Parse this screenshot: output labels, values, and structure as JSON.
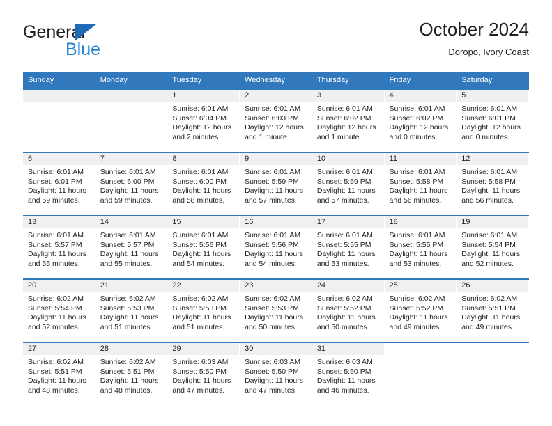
{
  "brand": {
    "word_one": "General",
    "word_two": "Blue",
    "flag_icon": "triangle-flag-icon",
    "colors": {
      "blue": "#2183d4",
      "flag": "#1f6cb4",
      "dark": "#231f20"
    }
  },
  "header": {
    "title": "October 2024",
    "subtitle": "Doropo, Ivory Coast"
  },
  "calendar": {
    "accent_color": "#3278bd",
    "daynum_bg": "#f0f0f0",
    "weekday_headers": [
      "Sunday",
      "Monday",
      "Tuesday",
      "Wednesday",
      "Thursday",
      "Friday",
      "Saturday"
    ],
    "weeks": [
      [
        {
          "day": "",
          "lines": []
        },
        {
          "day": "",
          "lines": []
        },
        {
          "day": "1",
          "lines": [
            "Sunrise: 6:01 AM",
            "Sunset: 6:04 PM",
            "Daylight: 12 hours and 2 minutes."
          ]
        },
        {
          "day": "2",
          "lines": [
            "Sunrise: 6:01 AM",
            "Sunset: 6:03 PM",
            "Daylight: 12 hours and 1 minute."
          ]
        },
        {
          "day": "3",
          "lines": [
            "Sunrise: 6:01 AM",
            "Sunset: 6:02 PM",
            "Daylight: 12 hours and 1 minute."
          ]
        },
        {
          "day": "4",
          "lines": [
            "Sunrise: 6:01 AM",
            "Sunset: 6:02 PM",
            "Daylight: 12 hours and 0 minutes."
          ]
        },
        {
          "day": "5",
          "lines": [
            "Sunrise: 6:01 AM",
            "Sunset: 6:01 PM",
            "Daylight: 12 hours and 0 minutes."
          ]
        }
      ],
      [
        {
          "day": "6",
          "lines": [
            "Sunrise: 6:01 AM",
            "Sunset: 6:01 PM",
            "Daylight: 11 hours and 59 minutes."
          ]
        },
        {
          "day": "7",
          "lines": [
            "Sunrise: 6:01 AM",
            "Sunset: 6:00 PM",
            "Daylight: 11 hours and 59 minutes."
          ]
        },
        {
          "day": "8",
          "lines": [
            "Sunrise: 6:01 AM",
            "Sunset: 6:00 PM",
            "Daylight: 11 hours and 58 minutes."
          ]
        },
        {
          "day": "9",
          "lines": [
            "Sunrise: 6:01 AM",
            "Sunset: 5:59 PM",
            "Daylight: 11 hours and 57 minutes."
          ]
        },
        {
          "day": "10",
          "lines": [
            "Sunrise: 6:01 AM",
            "Sunset: 5:59 PM",
            "Daylight: 11 hours and 57 minutes."
          ]
        },
        {
          "day": "11",
          "lines": [
            "Sunrise: 6:01 AM",
            "Sunset: 5:58 PM",
            "Daylight: 11 hours and 56 minutes."
          ]
        },
        {
          "day": "12",
          "lines": [
            "Sunrise: 6:01 AM",
            "Sunset: 5:58 PM",
            "Daylight: 11 hours and 56 minutes."
          ]
        }
      ],
      [
        {
          "day": "13",
          "lines": [
            "Sunrise: 6:01 AM",
            "Sunset: 5:57 PM",
            "Daylight: 11 hours and 55 minutes."
          ]
        },
        {
          "day": "14",
          "lines": [
            "Sunrise: 6:01 AM",
            "Sunset: 5:57 PM",
            "Daylight: 11 hours and 55 minutes."
          ]
        },
        {
          "day": "15",
          "lines": [
            "Sunrise: 6:01 AM",
            "Sunset: 5:56 PM",
            "Daylight: 11 hours and 54 minutes."
          ]
        },
        {
          "day": "16",
          "lines": [
            "Sunrise: 6:01 AM",
            "Sunset: 5:56 PM",
            "Daylight: 11 hours and 54 minutes."
          ]
        },
        {
          "day": "17",
          "lines": [
            "Sunrise: 6:01 AM",
            "Sunset: 5:55 PM",
            "Daylight: 11 hours and 53 minutes."
          ]
        },
        {
          "day": "18",
          "lines": [
            "Sunrise: 6:01 AM",
            "Sunset: 5:55 PM",
            "Daylight: 11 hours and 53 minutes."
          ]
        },
        {
          "day": "19",
          "lines": [
            "Sunrise: 6:01 AM",
            "Sunset: 5:54 PM",
            "Daylight: 11 hours and 52 minutes."
          ]
        }
      ],
      [
        {
          "day": "20",
          "lines": [
            "Sunrise: 6:02 AM",
            "Sunset: 5:54 PM",
            "Daylight: 11 hours and 52 minutes."
          ]
        },
        {
          "day": "21",
          "lines": [
            "Sunrise: 6:02 AM",
            "Sunset: 5:53 PM",
            "Daylight: 11 hours and 51 minutes."
          ]
        },
        {
          "day": "22",
          "lines": [
            "Sunrise: 6:02 AM",
            "Sunset: 5:53 PM",
            "Daylight: 11 hours and 51 minutes."
          ]
        },
        {
          "day": "23",
          "lines": [
            "Sunrise: 6:02 AM",
            "Sunset: 5:53 PM",
            "Daylight: 11 hours and 50 minutes."
          ]
        },
        {
          "day": "24",
          "lines": [
            "Sunrise: 6:02 AM",
            "Sunset: 5:52 PM",
            "Daylight: 11 hours and 50 minutes."
          ]
        },
        {
          "day": "25",
          "lines": [
            "Sunrise: 6:02 AM",
            "Sunset: 5:52 PM",
            "Daylight: 11 hours and 49 minutes."
          ]
        },
        {
          "day": "26",
          "lines": [
            "Sunrise: 6:02 AM",
            "Sunset: 5:51 PM",
            "Daylight: 11 hours and 49 minutes."
          ]
        }
      ],
      [
        {
          "day": "27",
          "lines": [
            "Sunrise: 6:02 AM",
            "Sunset: 5:51 PM",
            "Daylight: 11 hours and 48 minutes."
          ]
        },
        {
          "day": "28",
          "lines": [
            "Sunrise: 6:02 AM",
            "Sunset: 5:51 PM",
            "Daylight: 11 hours and 48 minutes."
          ]
        },
        {
          "day": "29",
          "lines": [
            "Sunrise: 6:03 AM",
            "Sunset: 5:50 PM",
            "Daylight: 11 hours and 47 minutes."
          ]
        },
        {
          "day": "30",
          "lines": [
            "Sunrise: 6:03 AM",
            "Sunset: 5:50 PM",
            "Daylight: 11 hours and 47 minutes."
          ]
        },
        {
          "day": "31",
          "lines": [
            "Sunrise: 6:03 AM",
            "Sunset: 5:50 PM",
            "Daylight: 11 hours and 46 minutes."
          ]
        },
        {
          "day": "",
          "lines": []
        },
        {
          "day": "",
          "lines": []
        }
      ]
    ]
  }
}
